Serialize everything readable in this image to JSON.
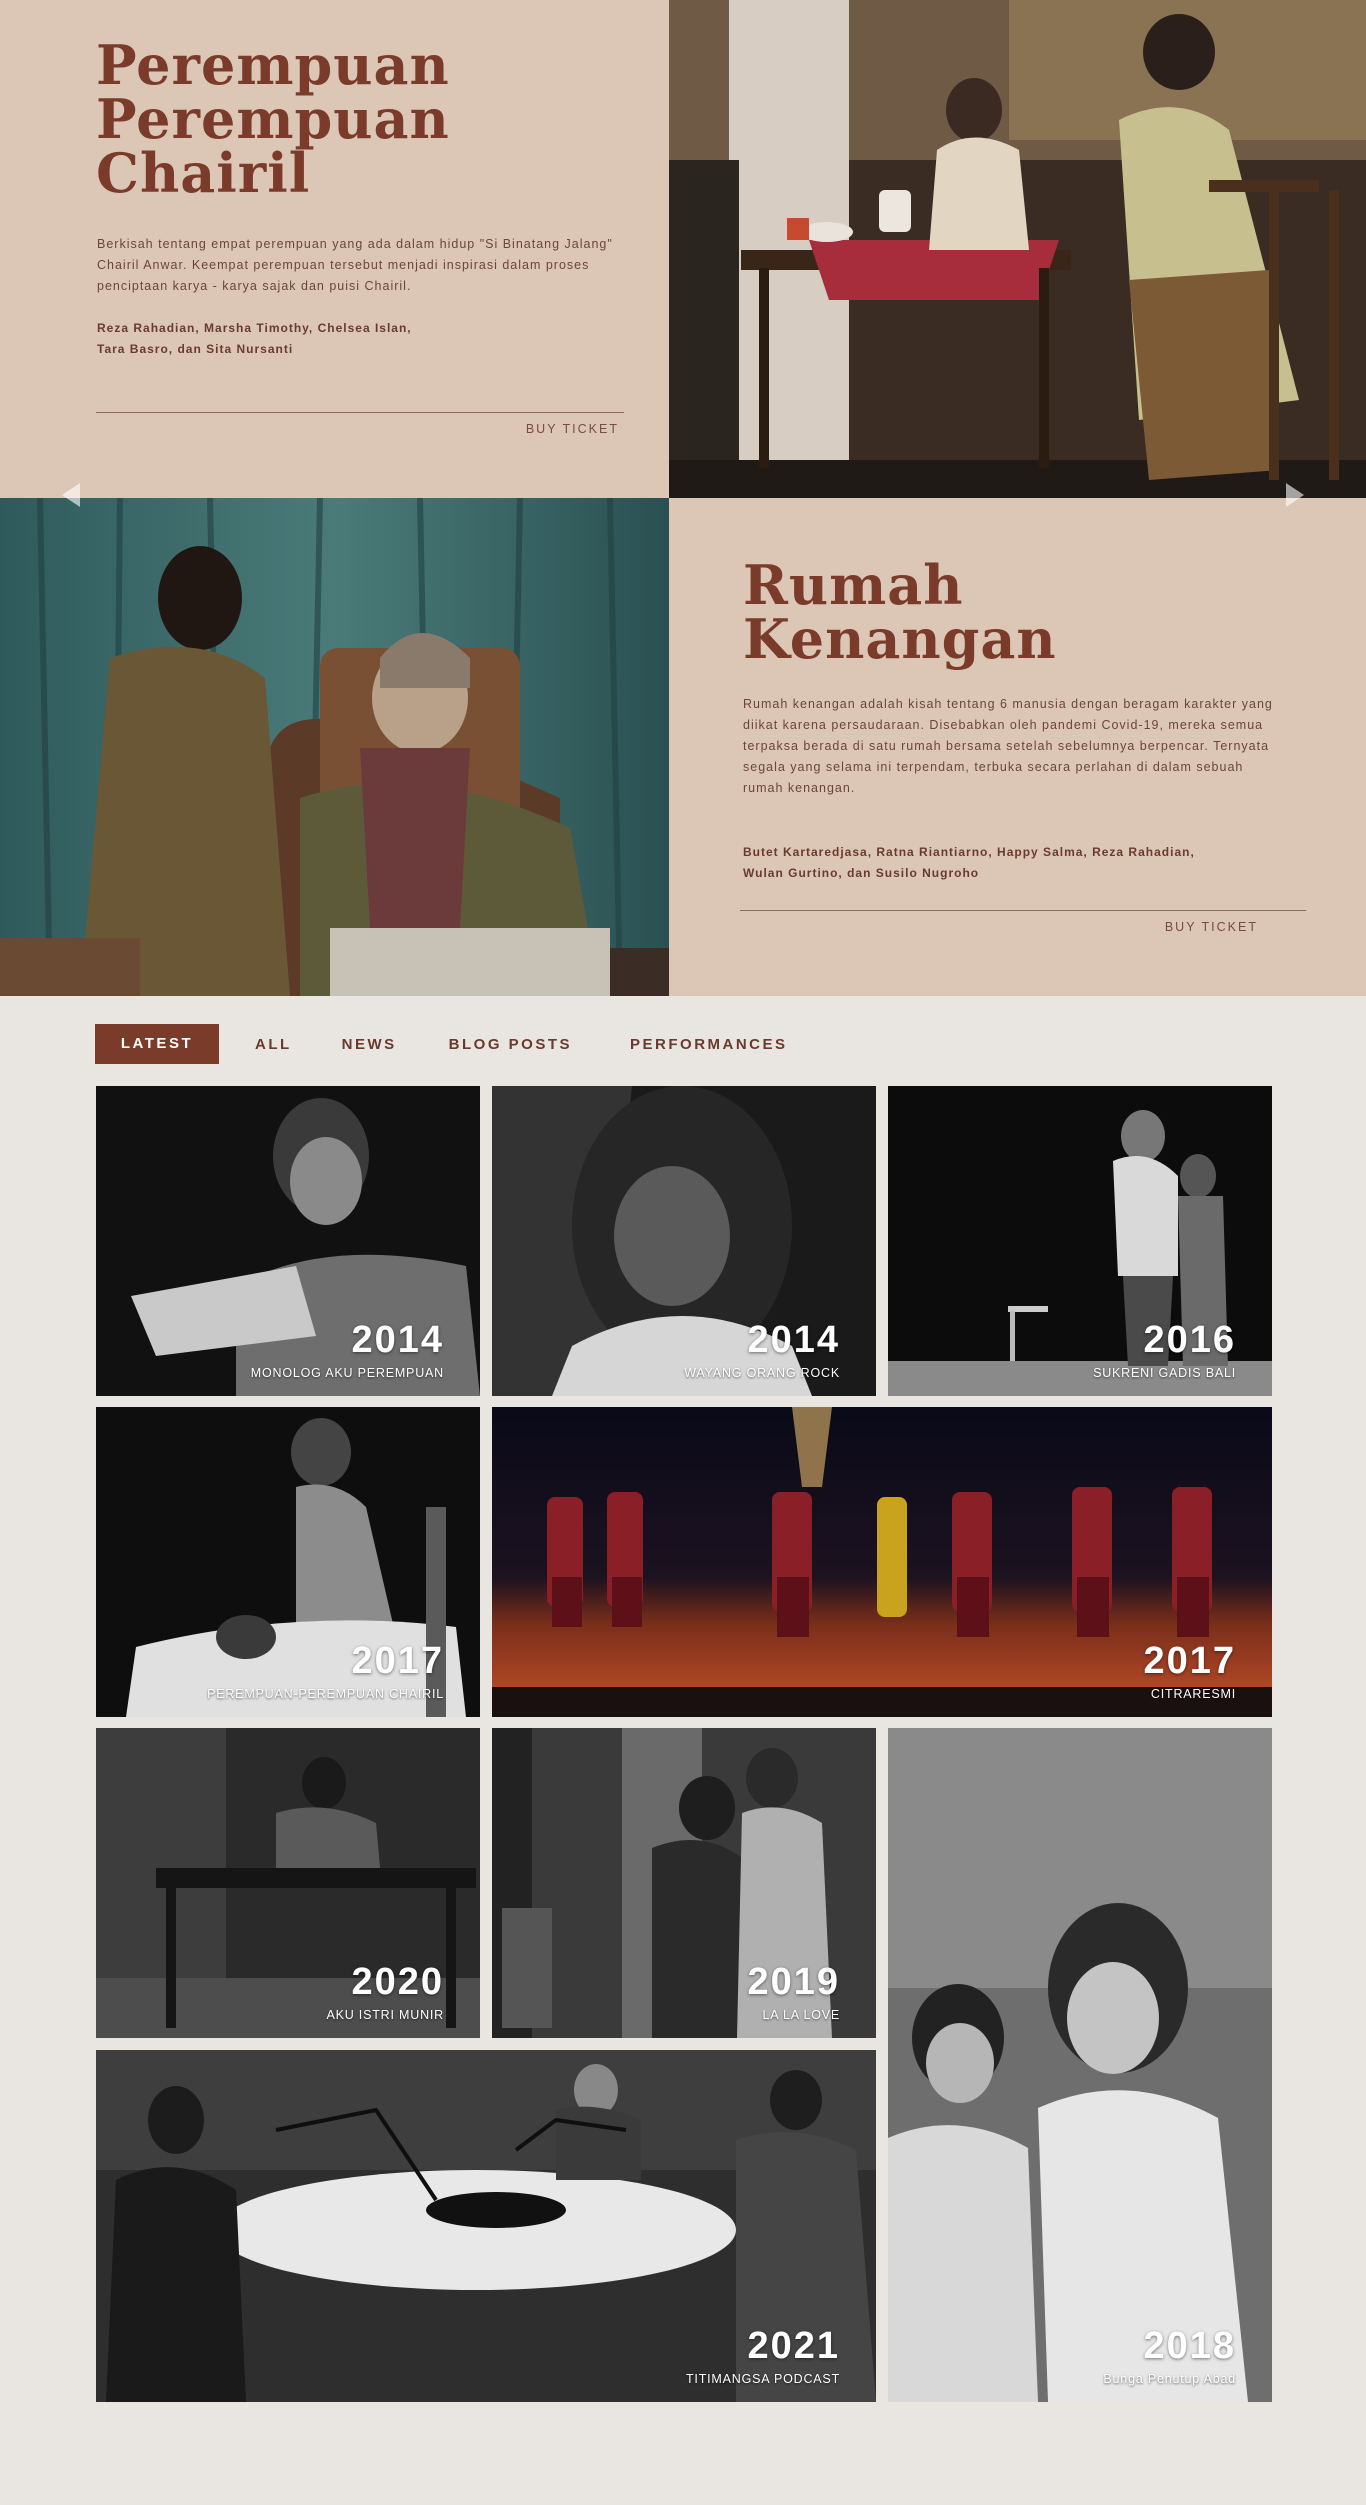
{
  "hero": {
    "show1": {
      "title": "Perempuan\nPerempuan\nChairil",
      "description": "Berkisah tentang empat perempuan yang ada dalam hidup \"Si Binatang Jalang\" Chairil Anwar. Keempat perempuan tersebut menjadi inspirasi dalam proses penciptaan karya - karya sajak dan puisi Chairil.",
      "cast_line1": "Reza Rahadian, Marsha Timothy, Chelsea Islan,",
      "cast_line2": "Tara Basro, dan Sita Nursanti",
      "ticket_label": "BUY TICKET"
    },
    "show2": {
      "title": "Rumah\nKenangan",
      "description": "Rumah kenangan adalah kisah tentang 6 manusia dengan beragam karakter yang diikat karena persaudaraan. Disebabkan oleh pandemi Covid-19, mereka semua terpaksa berada di satu rumah bersama setelah sebelumnya berpencar. Ternyata segala yang selama ini terpendam, terbuka secara perlahan di dalam sebuah rumah kenangan.",
      "cast_line1": "Butet Kartaredjasa, Ratna Riantiarno, Happy Salma, Reza Rahadian,",
      "cast_line2": "Wulan Gurtino, dan Susilo Nugroho",
      "ticket_label": "BUY TICKET"
    }
  },
  "filters": {
    "latest": "LATEST",
    "all": "ALL",
    "news": "NEWS",
    "blog": "BLOG POSTS",
    "performances": "PERFORMANCES"
  },
  "tiles": [
    {
      "year": "2014",
      "caption": "MONOLOG AKU PEREMPUAN"
    },
    {
      "year": "2014",
      "caption": "WAYANG ORANG ROCK"
    },
    {
      "year": "2016",
      "caption": "SUKRENI GADIS BALI"
    },
    {
      "year": "2017",
      "caption": "PEREMPUAN-PEREMPUAN CHAIRIL"
    },
    {
      "year": "2017",
      "caption": "CITRARESMI"
    },
    {
      "year": "2020",
      "caption": "AKU ISTRI MUNIR"
    },
    {
      "year": "2019",
      "caption": "LA LA LOVE"
    },
    {
      "year": "2018",
      "caption": "Bunga Penutup Abad"
    },
    {
      "year": "2021",
      "caption": "TITIMANGSA PODCAST"
    }
  ],
  "colors": {
    "panel": "#dcc7b7",
    "accent": "#7b3b2b",
    "page_background": "#e9e5e0"
  }
}
